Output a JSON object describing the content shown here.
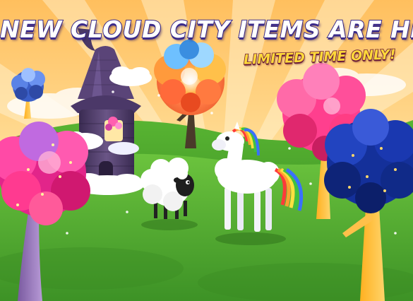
{
  "banner": {
    "headline": "NEW CLOUD CITY ITEMS ARE HERE!",
    "subheadline": "LIMITED TIME ONLY!"
  },
  "palette": {
    "sky_top": "#ffbf5e",
    "sky_bottom": "#ffe9b0",
    "grass": "#4aa52e",
    "grass_dark": "#2f7d1e",
    "headline_text": "#ffffff",
    "headline_outline": "#3a2a8a",
    "subheadline_text": "#ffd93a",
    "subheadline_outline": "#6a1a3a"
  },
  "scene_items": [
    {
      "name": "small-blue-tree",
      "icon": "tree-icon"
    },
    {
      "name": "purple-cloud-tower",
      "icon": "tower-icon"
    },
    {
      "name": "rainbow-tree",
      "icon": "tree-icon"
    },
    {
      "name": "pink-tree",
      "icon": "tree-icon"
    },
    {
      "name": "magenta-tree",
      "icon": "tree-icon"
    },
    {
      "name": "navy-blue-tree",
      "icon": "tree-icon"
    },
    {
      "name": "cloud-sheep",
      "icon": "sheep-icon"
    },
    {
      "name": "rainbow-cloud-pony",
      "icon": "pony-icon"
    }
  ]
}
